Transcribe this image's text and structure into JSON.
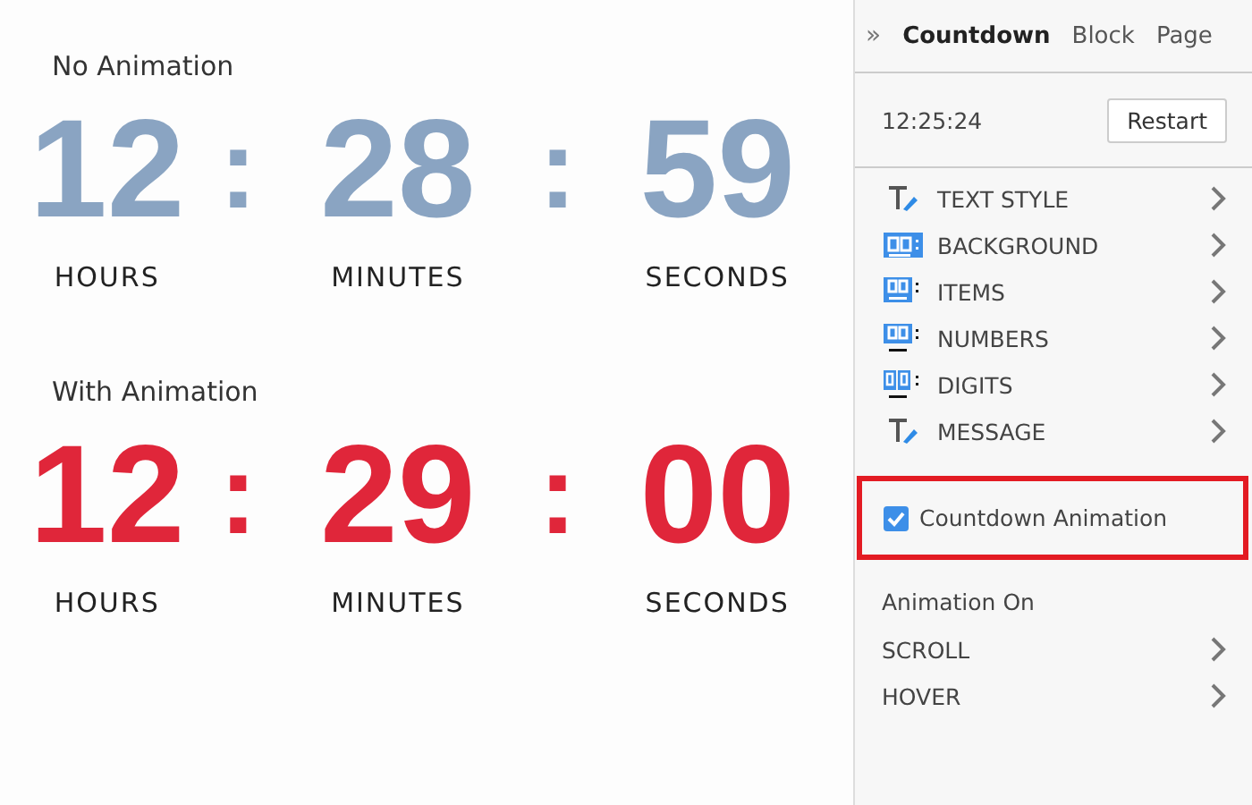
{
  "timers": [
    {
      "title": "No Animation",
      "color": "#8aa4c2",
      "units": [
        {
          "value": "12",
          "label": "HOURS"
        },
        {
          "value": "28",
          "label": "MINUTES"
        },
        {
          "value": "59",
          "label": "SECONDS"
        }
      ],
      "separator": ":"
    },
    {
      "title": "With Animation",
      "color": "#e0263a",
      "units": [
        {
          "value": "12",
          "label": "HOURS"
        },
        {
          "value": "29",
          "label": "MINUTES"
        },
        {
          "value": "00",
          "label": "SECONDS"
        }
      ],
      "separator": ":"
    }
  ],
  "panel": {
    "collapse": "»",
    "tabs": [
      {
        "label": "Countdown",
        "selected": true
      },
      {
        "label": "Block",
        "selected": false
      },
      {
        "label": "Page",
        "selected": false
      }
    ],
    "time": "12:25:24",
    "restart": "Restart",
    "style_items": [
      {
        "label": "TEXT STYLE",
        "kind": "text"
      },
      {
        "label": "BACKGROUND",
        "kind": "background"
      },
      {
        "label": "ITEMS",
        "kind": "items"
      },
      {
        "label": "NUMBERS",
        "kind": "numbers"
      },
      {
        "label": "DIGITS",
        "kind": "digits"
      },
      {
        "label": "MESSAGE",
        "kind": "text"
      }
    ],
    "animation_toggle": {
      "label": "Countdown Animation",
      "checked": true
    },
    "animation_on_title": "Animation On",
    "animation_on": [
      {
        "label": "SCROLL"
      },
      {
        "label": "HOVER"
      }
    ]
  }
}
